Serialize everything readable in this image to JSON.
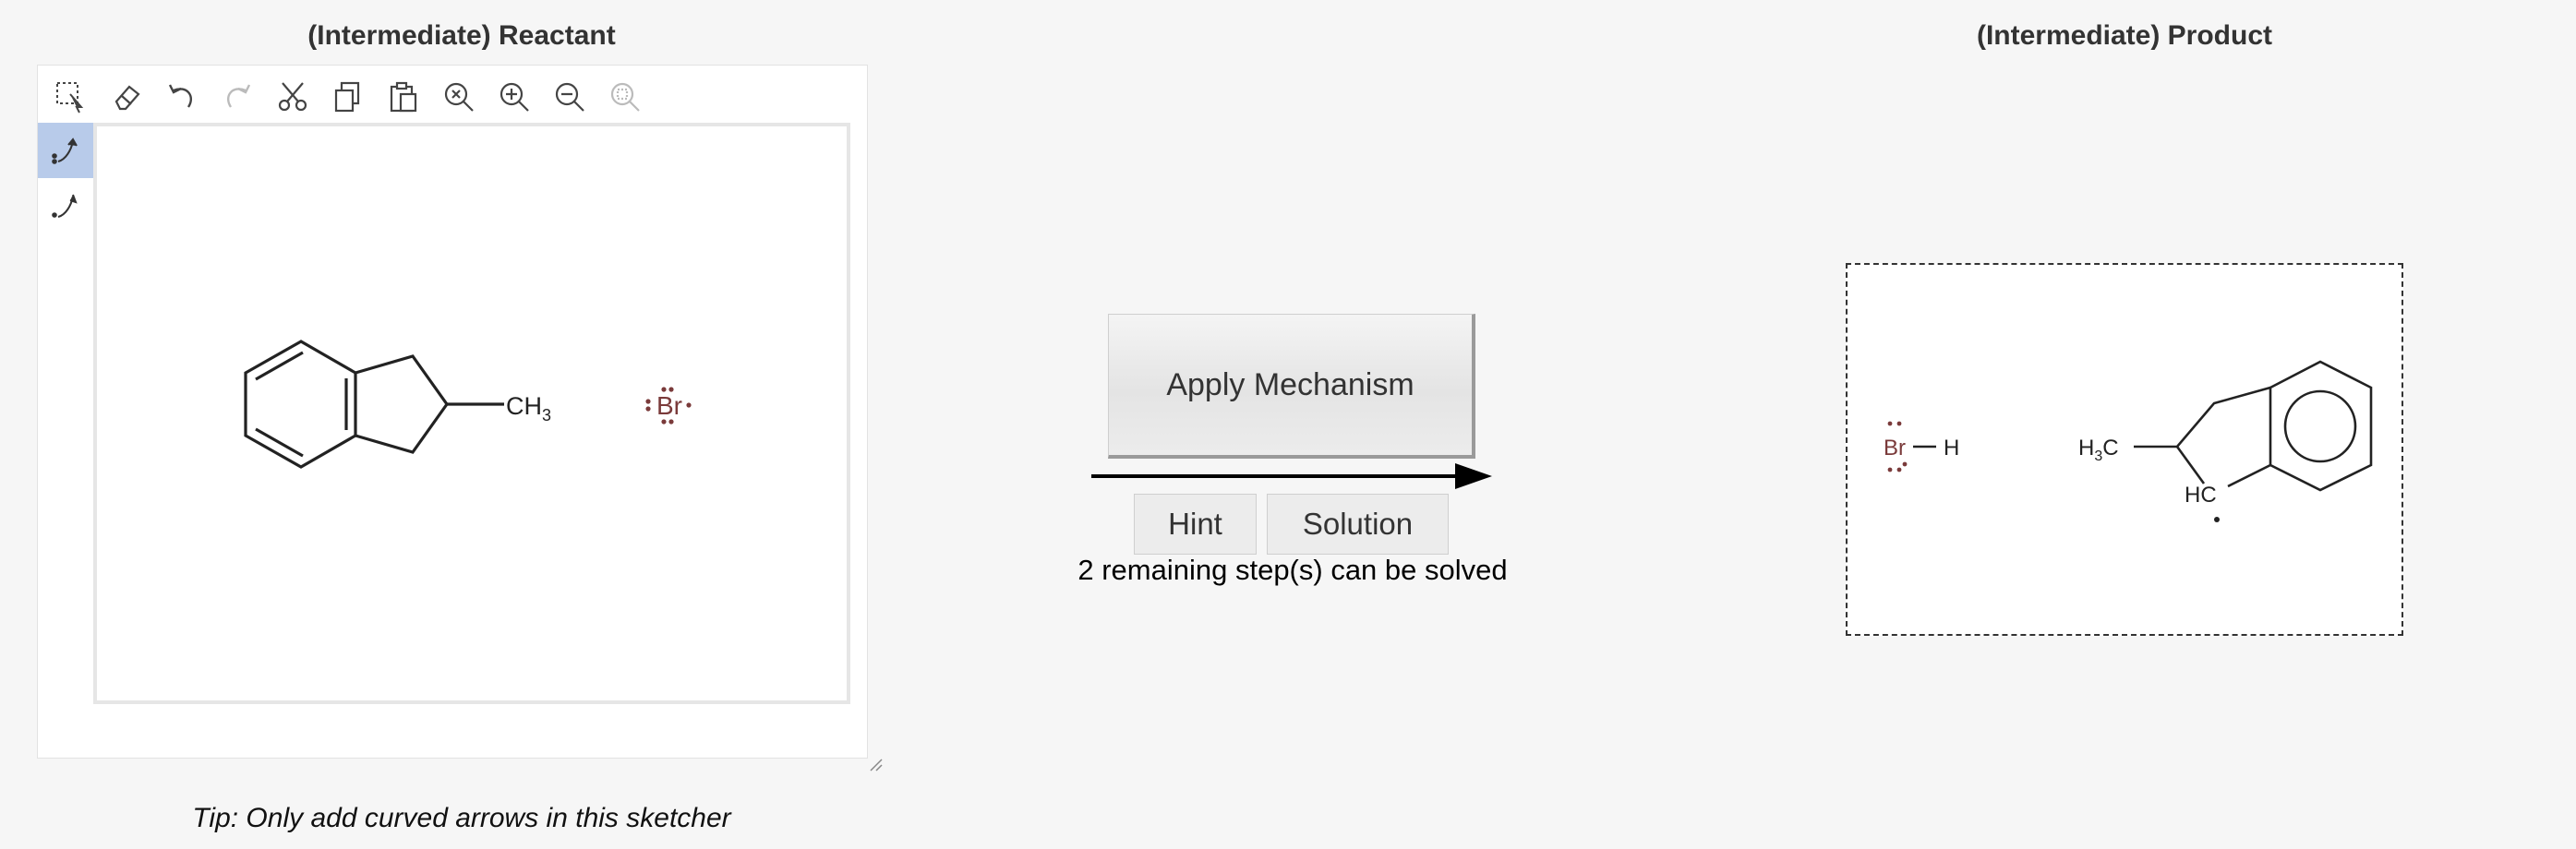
{
  "reactant": {
    "title": "(Intermediate) Reactant",
    "toolbar": [
      {
        "icon": "selection-icon",
        "disabled": false
      },
      {
        "icon": "eraser-icon",
        "disabled": false
      },
      {
        "icon": "undo-icon",
        "disabled": false
      },
      {
        "icon": "redo-icon",
        "disabled": true
      },
      {
        "icon": "cut-icon",
        "disabled": false
      },
      {
        "icon": "copy-icon",
        "disabled": false
      },
      {
        "icon": "paste-icon",
        "disabled": false
      },
      {
        "icon": "clear-icon",
        "disabled": false
      },
      {
        "icon": "zoom-in-icon",
        "disabled": false
      },
      {
        "icon": "zoom-out-icon",
        "disabled": false
      },
      {
        "icon": "zoom-reset-icon",
        "disabled": true
      }
    ],
    "side_tools": [
      {
        "icon": "electron-pair-arrow-icon",
        "active": true
      },
      {
        "icon": "single-electron-arrow-icon",
        "active": false
      }
    ],
    "molecule": {
      "substituent": "CH",
      "substituent_sub": "3",
      "reagent": "Br"
    },
    "tip": "Tip: Only add curved arrows in this sketcher"
  },
  "middle": {
    "apply_label": "Apply Mechanism",
    "hint_label": "Hint",
    "solution_label": "Solution",
    "remaining_text": "2 remaining step(s) can be solved"
  },
  "product": {
    "title": "(Intermediate) Product",
    "hbr": {
      "br": "Br",
      "h": "H"
    },
    "ring": {
      "methyl": "H",
      "methyl_sub": "3",
      "methyl_c": "C",
      "carbocation": "HC"
    }
  },
  "colors": {
    "background": "#f6f6f6",
    "active_tool": "#b8cbea",
    "bromine": "#7a3a3a",
    "bond": "#222222"
  }
}
